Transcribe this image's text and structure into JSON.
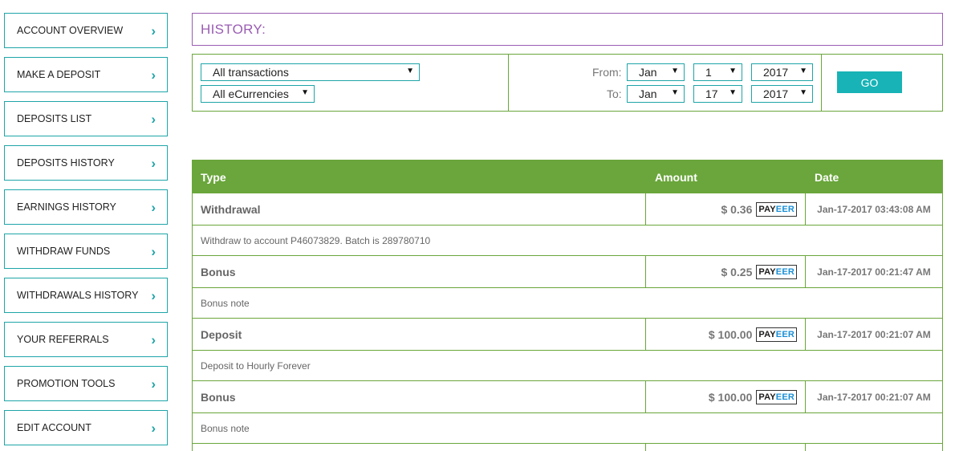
{
  "sidebar": {
    "items": [
      {
        "label": "ACCOUNT OVERVIEW"
      },
      {
        "label": "MAKE A DEPOSIT"
      },
      {
        "label": "DEPOSITS LIST"
      },
      {
        "label": "DEPOSITS HISTORY"
      },
      {
        "label": "EARNINGS HISTORY"
      },
      {
        "label": "WITHDRAW FUNDS"
      },
      {
        "label": "WITHDRAWALS HISTORY"
      },
      {
        "label": "YOUR REFERRALS"
      },
      {
        "label": "PROMOTION TOOLS"
      },
      {
        "label": "EDIT ACCOUNT"
      }
    ],
    "chevron": "›"
  },
  "history_title": "HISTORY:",
  "filters": {
    "transaction_type": "All transactions",
    "currency": "All eCurrencies",
    "from_label": "From:",
    "to_label": "To:",
    "from": {
      "month": "Jan",
      "day": "1",
      "year": "2017"
    },
    "to": {
      "month": "Jan",
      "day": "17",
      "year": "2017"
    },
    "go_label": "GO",
    "dropdown_arrow": "▼"
  },
  "table": {
    "headers": {
      "type": "Type",
      "amount": "Amount",
      "date": "Date"
    },
    "rows": [
      {
        "type": "Withdrawal",
        "amount": "$ 0.36",
        "date": "Jan-17-2017 03:43:08 AM",
        "note": "Withdraw to account P46073829. Batch is 289780710"
      },
      {
        "type": "Bonus",
        "amount": "$ 0.25",
        "date": "Jan-17-2017 00:21:47 AM",
        "note": "Bonus note"
      },
      {
        "type": "Deposit",
        "amount": "$ 100.00",
        "date": "Jan-17-2017 00:21:07 AM",
        "note": "Deposit to Hourly Forever"
      },
      {
        "type": "Bonus",
        "amount": "$ 100.00",
        "date": "Jan-17-2017 00:21:07 AM",
        "note": "Bonus note"
      }
    ],
    "payeer_logo": {
      "part1": "PAY",
      "part2": "EER"
    }
  },
  "colors": {
    "teal": "#1fa5a8",
    "purple": "#9a5db3",
    "green": "#6aa63b"
  }
}
